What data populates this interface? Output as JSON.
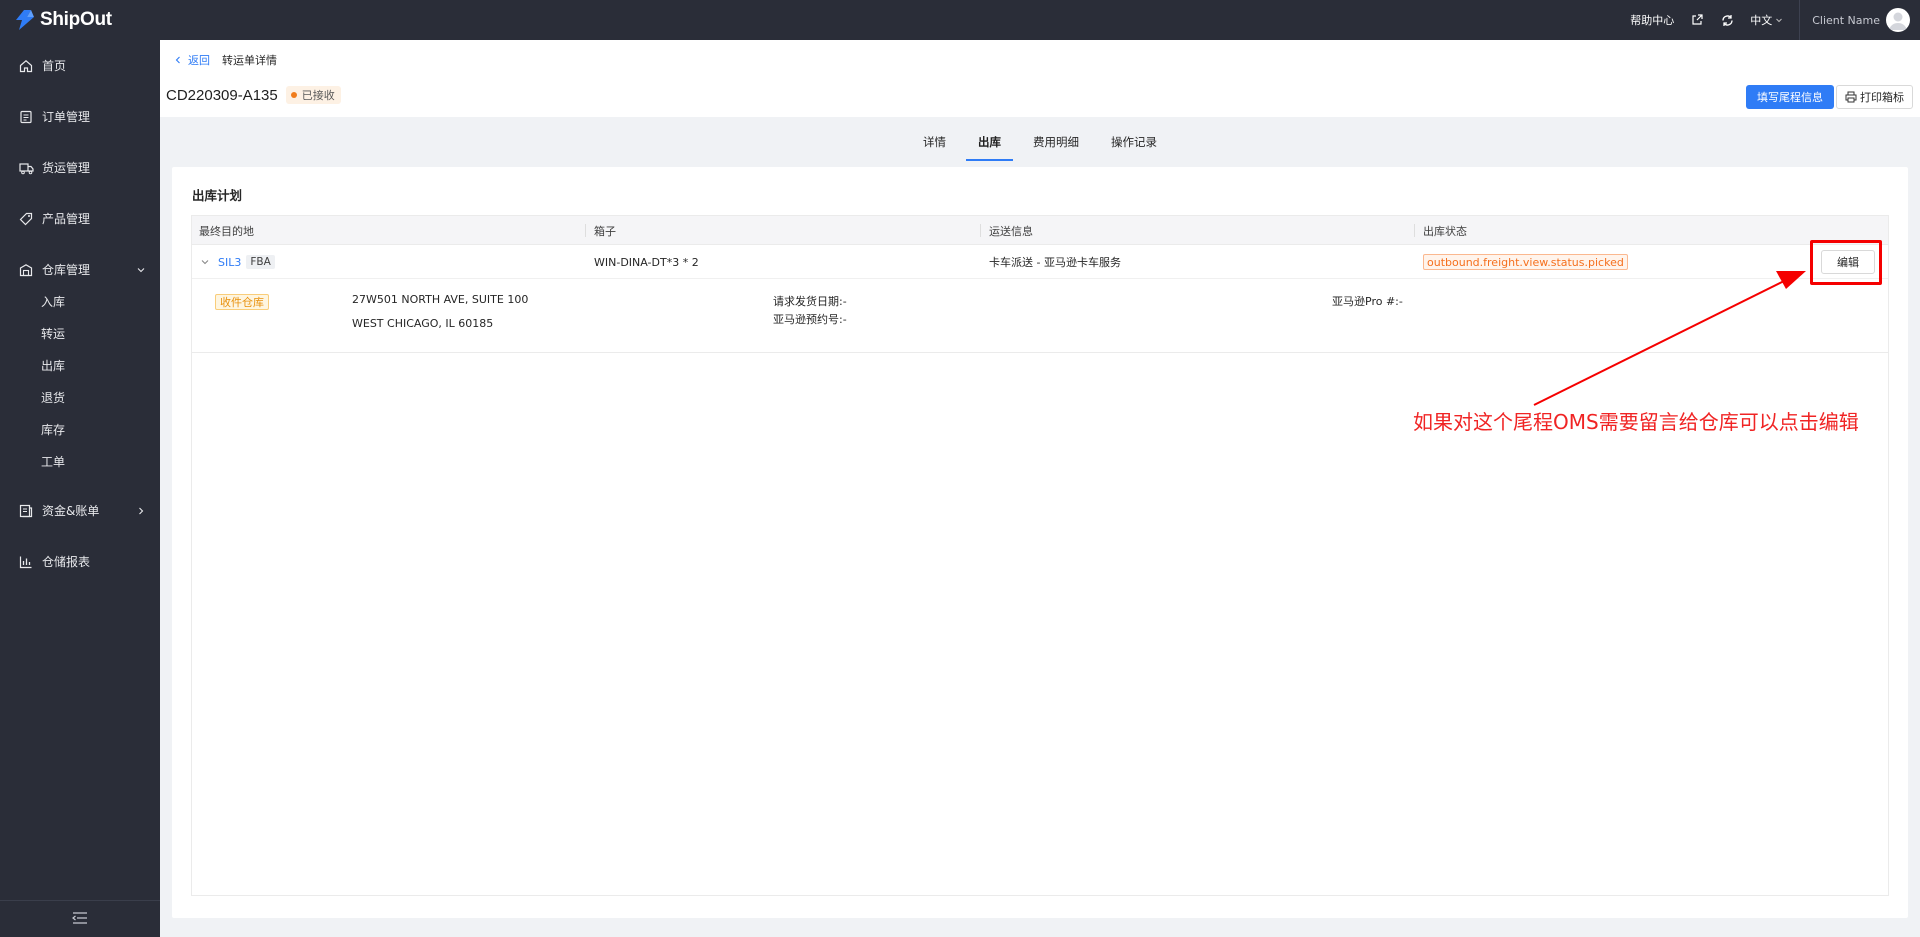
{
  "app": {
    "logo_text": "ShipOut"
  },
  "topbar": {
    "help_label": "帮助中心",
    "lang_label": "中文",
    "client_name": "Client Name"
  },
  "sidebar": {
    "items": [
      {
        "label": "首页",
        "icon": "home-icon"
      },
      {
        "label": "订单管理",
        "icon": "order-icon"
      },
      {
        "label": "货运管理",
        "icon": "truck-icon"
      },
      {
        "label": "产品管理",
        "icon": "tag-icon"
      },
      {
        "label": "仓库管理",
        "icon": "warehouse-icon",
        "expanded": true,
        "children": [
          "入库",
          "转运",
          "出库",
          "退货",
          "库存",
          "工单"
        ]
      },
      {
        "label": "资金&账单",
        "icon": "bill-icon"
      },
      {
        "label": "仓储报表",
        "icon": "chart-icon"
      }
    ]
  },
  "breadcrumb": {
    "back_label": "返回",
    "current": "转运单详情"
  },
  "header": {
    "title": "CD220309-A135",
    "status": "已接收",
    "primary_btn": "填写尾程信息",
    "print_btn": "打印箱标"
  },
  "tabs": [
    {
      "label": "详情",
      "active": false
    },
    {
      "label": "出库",
      "active": true
    },
    {
      "label": "费用明细",
      "active": false
    },
    {
      "label": "操作记录",
      "active": false
    }
  ],
  "plan": {
    "section_title": "出库计划",
    "columns": [
      "最终目的地",
      "箱子",
      "运送信息",
      "出库状态"
    ],
    "row": {
      "destination": "SIL3",
      "destination_tag": "FBA",
      "box": "WIN-DINA-DT*3 * 2",
      "shipping": "卡车派送 - 亚马逊卡车服务",
      "status": "outbound.freight.view.status.picked",
      "edit_btn": "编辑"
    },
    "detail": {
      "warehouse_tag": "收件仓库",
      "address_line1": "27W501 NORTH AVE, SUITE 100",
      "address_line2": "WEST CHICAGO, IL 60185",
      "request_date": "请求发货日期:-",
      "amazon_appt": "亚马逊预约号:-",
      "amazon_pro": "亚马逊Pro #:-"
    }
  },
  "annotation": {
    "text": "如果对这个尾程OMS需要留言给仓库可以点击编辑",
    "color": "#f02424"
  },
  "colors": {
    "accent": "#2f7cf6",
    "sidebar_bg": "#2a2d38",
    "status_orange": "#f5701e"
  }
}
